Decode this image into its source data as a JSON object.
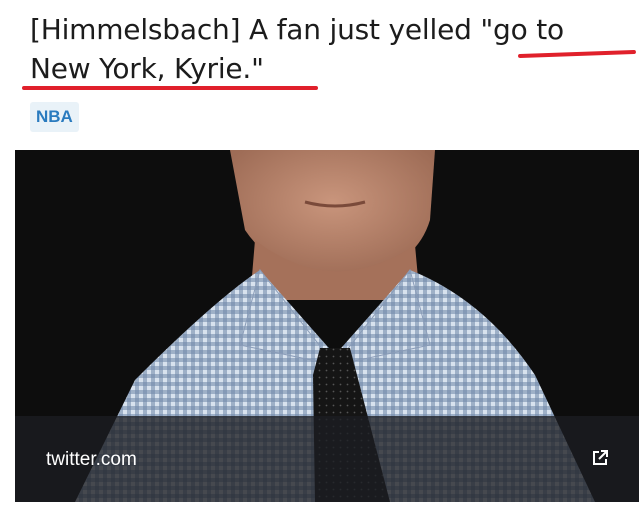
{
  "post": {
    "title": "[Himmelsbach] A fan just yelled \"go to New York, Kyrie.\"",
    "flair": "NBA",
    "highlight_color": "#e0202b"
  },
  "embed": {
    "domain": "twitter.com",
    "icon": "external-link-icon"
  }
}
